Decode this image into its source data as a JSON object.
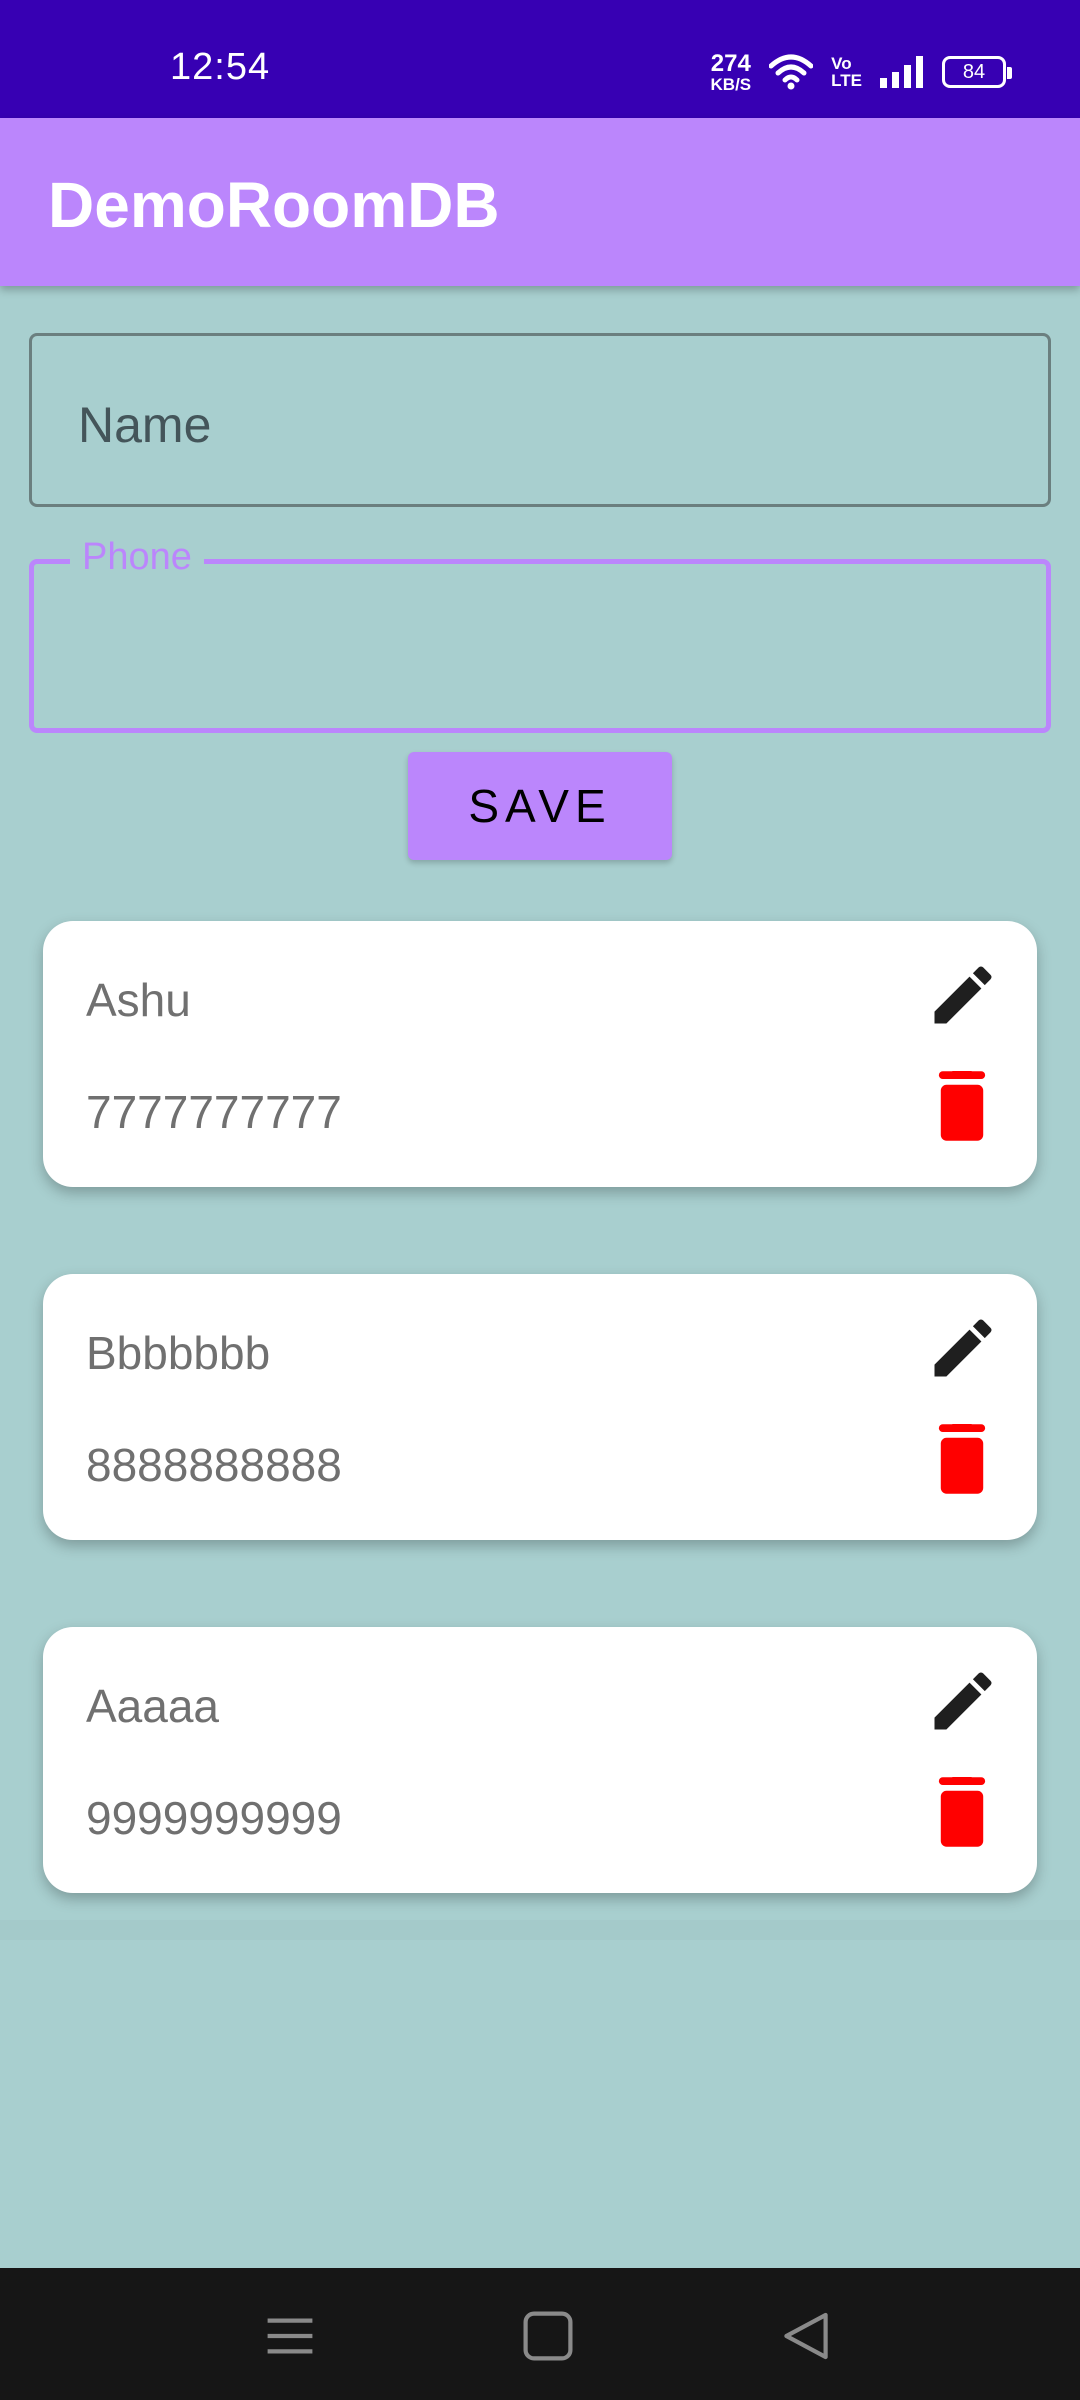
{
  "status_bar": {
    "time": "12:54",
    "speed_value": "274",
    "speed_unit": "KB/S",
    "volte_top": "Vo",
    "volte_bottom": "LTE",
    "battery": "84"
  },
  "app_bar": {
    "title": "DemoRoomDB"
  },
  "form": {
    "name_placeholder": "Name",
    "phone_label": "Phone",
    "save_label": "SAVE"
  },
  "contacts": [
    {
      "name": "Ashu",
      "phone": "7777777777"
    },
    {
      "name": "Bbbbbbb",
      "phone": "8888888888"
    },
    {
      "name": "Aaaaa",
      "phone": "9999999999"
    }
  ],
  "colors": {
    "status_bar": "#3700b3",
    "app_bar": "#bb86fc",
    "background": "#a8cfcf",
    "delete_icon": "#ff0000",
    "edit_icon": "#1f1f1f"
  },
  "icons": {
    "wifi": "wifi-icon",
    "signal": "signal-icon",
    "edit": "pencil-icon",
    "delete": "trash-icon",
    "nav_menu": "menu-icon",
    "nav_home": "square-icon",
    "nav_back": "back-triangle-icon"
  }
}
